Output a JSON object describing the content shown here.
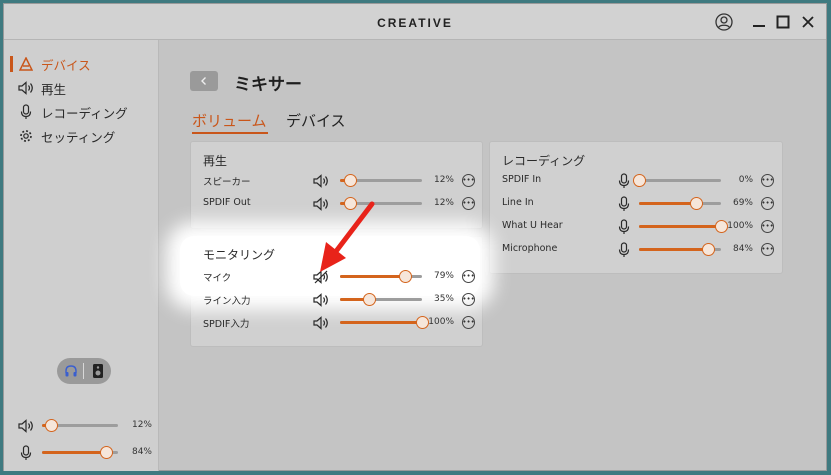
{
  "titlebar": {
    "brand": "CREATIVE"
  },
  "sidebar": {
    "items": [
      {
        "label": "デバイス",
        "icon": "device-icon",
        "active": true
      },
      {
        "label": "再生",
        "icon": "speaker-icon",
        "active": false
      },
      {
        "label": "レコーディング",
        "icon": "microphone-icon",
        "active": false
      },
      {
        "label": "セッティング",
        "icon": "gear-icon",
        "active": false
      }
    ],
    "output_toggle": {
      "options": [
        "headphones-icon",
        "speaker-box-icon"
      ],
      "selected": "headphones-icon"
    },
    "master_volume": {
      "value": 12,
      "label": "12%"
    },
    "mic_volume": {
      "value": 84,
      "label": "84%"
    }
  },
  "main": {
    "title": "ミキサー",
    "tabs": [
      {
        "label": "ボリューム",
        "active": true
      },
      {
        "label": "デバイス",
        "active": false
      }
    ]
  },
  "cards": {
    "playback": {
      "title": "再生",
      "rows": [
        {
          "label": "スピーカー",
          "value": 12,
          "pct": "12%"
        },
        {
          "label": "SPDIF Out",
          "value": 12,
          "pct": "12%"
        }
      ]
    },
    "monitoring": {
      "title": "モニタリング",
      "rows": [
        {
          "label": "マイク",
          "value": 79,
          "pct": "79%",
          "muted": true
        },
        {
          "label": "ライン入力",
          "value": 35,
          "pct": "35%"
        },
        {
          "label": "SPDIF入力",
          "value": 100,
          "pct": "100%"
        }
      ]
    },
    "recording": {
      "title": "レコーディング",
      "rows": [
        {
          "label": "SPDIF In",
          "value": 0,
          "pct": "0%"
        },
        {
          "label": "Line In",
          "value": 69,
          "pct": "69%"
        },
        {
          "label": "What U Hear",
          "value": 100,
          "pct": "100%"
        },
        {
          "label": "Microphone",
          "value": 84,
          "pct": "84%"
        }
      ]
    }
  },
  "colors": {
    "accent": "#d4641c",
    "annotation_arrow": "#e8231a"
  },
  "annotation": {
    "icon": "red-arrow-icon",
    "points_to": "monitoring-mic-mute-icon"
  }
}
